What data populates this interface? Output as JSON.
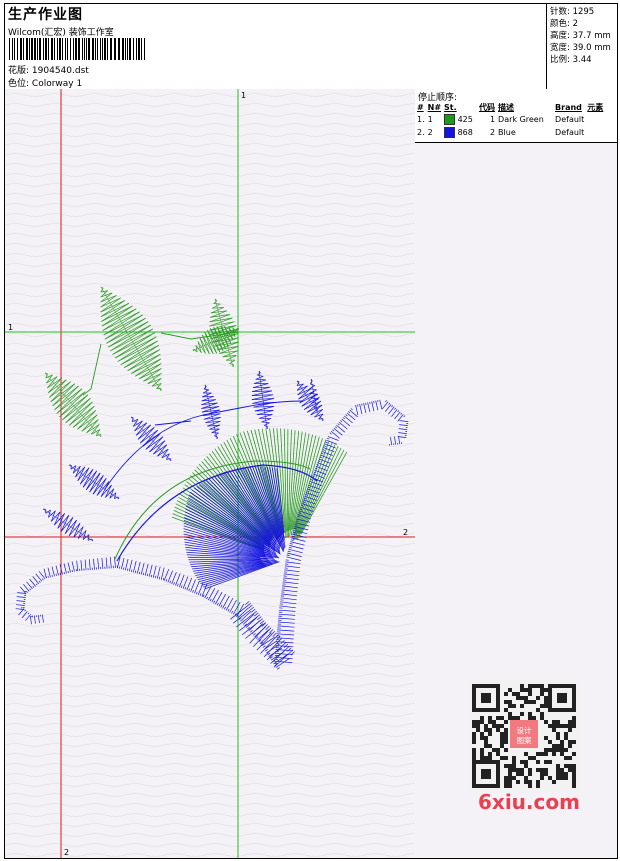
{
  "header": {
    "title": "生产作业图",
    "studio": "Wilcom(汇宏) 装饰工作室",
    "design_label": "花版:",
    "design_file": "1904540.dst",
    "colorway_label": "色位:",
    "colorway": "Colorway 1"
  },
  "stats": [
    {
      "label": "针数:",
      "value": "1295"
    },
    {
      "label": "颜色:",
      "value": "2"
    },
    {
      "label": "高度:",
      "value": "37.7 mm"
    },
    {
      "label": "宽度:",
      "value": "39.0 mm"
    },
    {
      "label": "比例:",
      "value": "3.44"
    }
  ],
  "stop_sequence": {
    "title": "停止顺序:",
    "columns": [
      "#",
      "N#",
      "St.",
      "代码",
      "描述",
      "Brand",
      "元素"
    ],
    "rows": [
      {
        "index": "1.",
        "n": "1",
        "color": "#1c9a1c",
        "code": "425",
        "st": "1",
        "desc": "Dark Green",
        "brand": "Default"
      },
      {
        "index": "2.",
        "n": "2",
        "color": "#1414e0",
        "code": "868",
        "st": "2",
        "desc": "Blue",
        "brand": "Default"
      }
    ]
  },
  "crosshair_labels": {
    "green_top": "1",
    "green_left": "1",
    "red_right": "2",
    "red_bottom": "2"
  },
  "colors": {
    "green_thread": "#2a9b22",
    "blue_thread": "#1515dd",
    "crosshair_green": "#22c022",
    "crosshair_red": "#e01818"
  },
  "watermark": "6xiu.com",
  "qr_badge": "设计图案"
}
